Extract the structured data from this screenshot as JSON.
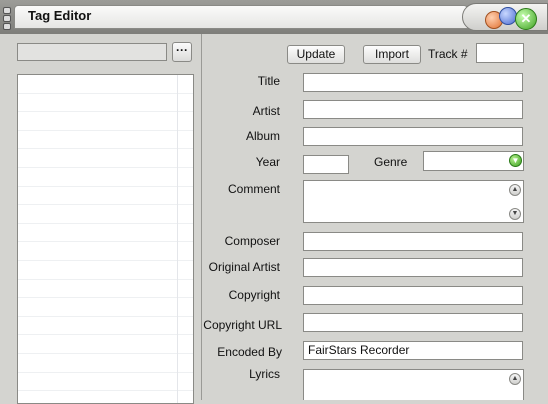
{
  "window": {
    "title": "Tag Editor",
    "close_glyph": "✕"
  },
  "left_panel": {
    "path_value": "",
    "browse_label": "···",
    "file_rows": 18
  },
  "toolbar": {
    "update_label": "Update",
    "import_label": "Import",
    "track_label": "Track #",
    "track_value": ""
  },
  "fields": {
    "title_label": "Title",
    "title_value": "",
    "artist_label": "Artist",
    "artist_value": "",
    "album_label": "Album",
    "album_value": "",
    "year_label": "Year",
    "year_value": "",
    "genre_label": "Genre",
    "genre_value": "",
    "comment_label": "Comment",
    "comment_value": "",
    "composer_label": "Composer",
    "composer_value": "",
    "original_artist_label": "Original Artist",
    "original_artist_value": "",
    "copyright_label": "Copyright",
    "copyright_value": "",
    "copyright_url_label": "Copyright URL",
    "copyright_url_value": "",
    "encoded_by_label": "Encoded By",
    "encoded_by_value": "FairStars Recorder",
    "lyrics_label": "Lyrics",
    "lyrics_value": ""
  },
  "icons": {
    "scroll_up": "▲",
    "scroll_down": "▼",
    "dropdown": "▼"
  },
  "colors": {
    "background": "#d4d4d0",
    "titlebar": "#8c8c88",
    "close_green": "#3ca020",
    "minimize_orange": "#e07030",
    "maximize_blue": "#4a6ad0"
  }
}
